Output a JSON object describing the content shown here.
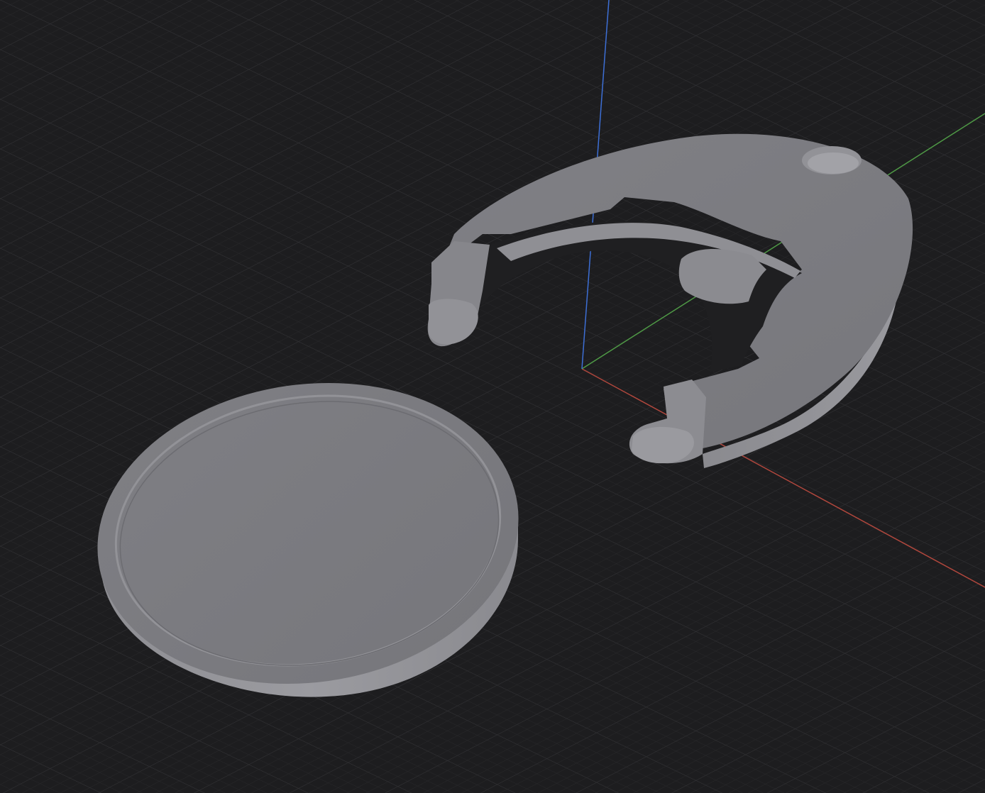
{
  "viewport": {
    "mode": "3d-perspective-view",
    "background": "#1d1d1f",
    "grid": {
      "visible": true,
      "minor_color": "#2b2b2d",
      "major_color": "#353538"
    },
    "axes": {
      "x_color": "#b0473d",
      "y_color": "#4f9a46",
      "z_color": "#3d6fd6"
    }
  },
  "models": [
    {
      "id": "coin-disc",
      "label": "",
      "color": "#8c8c91"
    },
    {
      "id": "clip-holder",
      "label": "",
      "color": "#8c8c91"
    }
  ]
}
